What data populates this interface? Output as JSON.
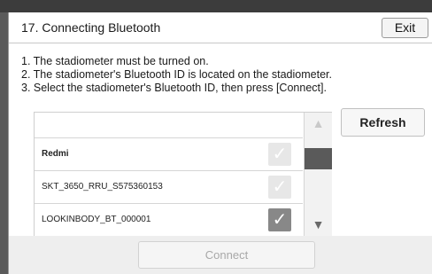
{
  "dialog": {
    "title": "17. Connecting Bluetooth",
    "exit_label": "Exit"
  },
  "instructions": [
    "1. The stadiometer must be turned on.",
    "2. The stadiometer's Bluetooth ID is located on the stadiometer.",
    "3. Select the stadiometer's Bluetooth ID, then press [Connect]."
  ],
  "device_list": {
    "items": [
      {
        "label": "",
        "selected": false
      },
      {
        "label": "Redmi",
        "selected": false
      },
      {
        "label": "SKT_3650_RRU_S575360153",
        "selected": false
      },
      {
        "label": "LOOKINBODY_BT_000001",
        "selected": true
      }
    ],
    "check_glyph": "✓",
    "scroll_up_glyph": "▲",
    "scroll_down_glyph": "▼"
  },
  "buttons": {
    "refresh_label": "Refresh",
    "connect_label": "Connect"
  },
  "icons": {
    "check": "check-icon",
    "scroll_up": "chevron-up-icon",
    "scroll_down": "chevron-down-icon"
  },
  "colors": {
    "selected_check": "#888888",
    "unselected_check": "#e7e7e7",
    "scroll_thumb": "#5a5a5a"
  }
}
